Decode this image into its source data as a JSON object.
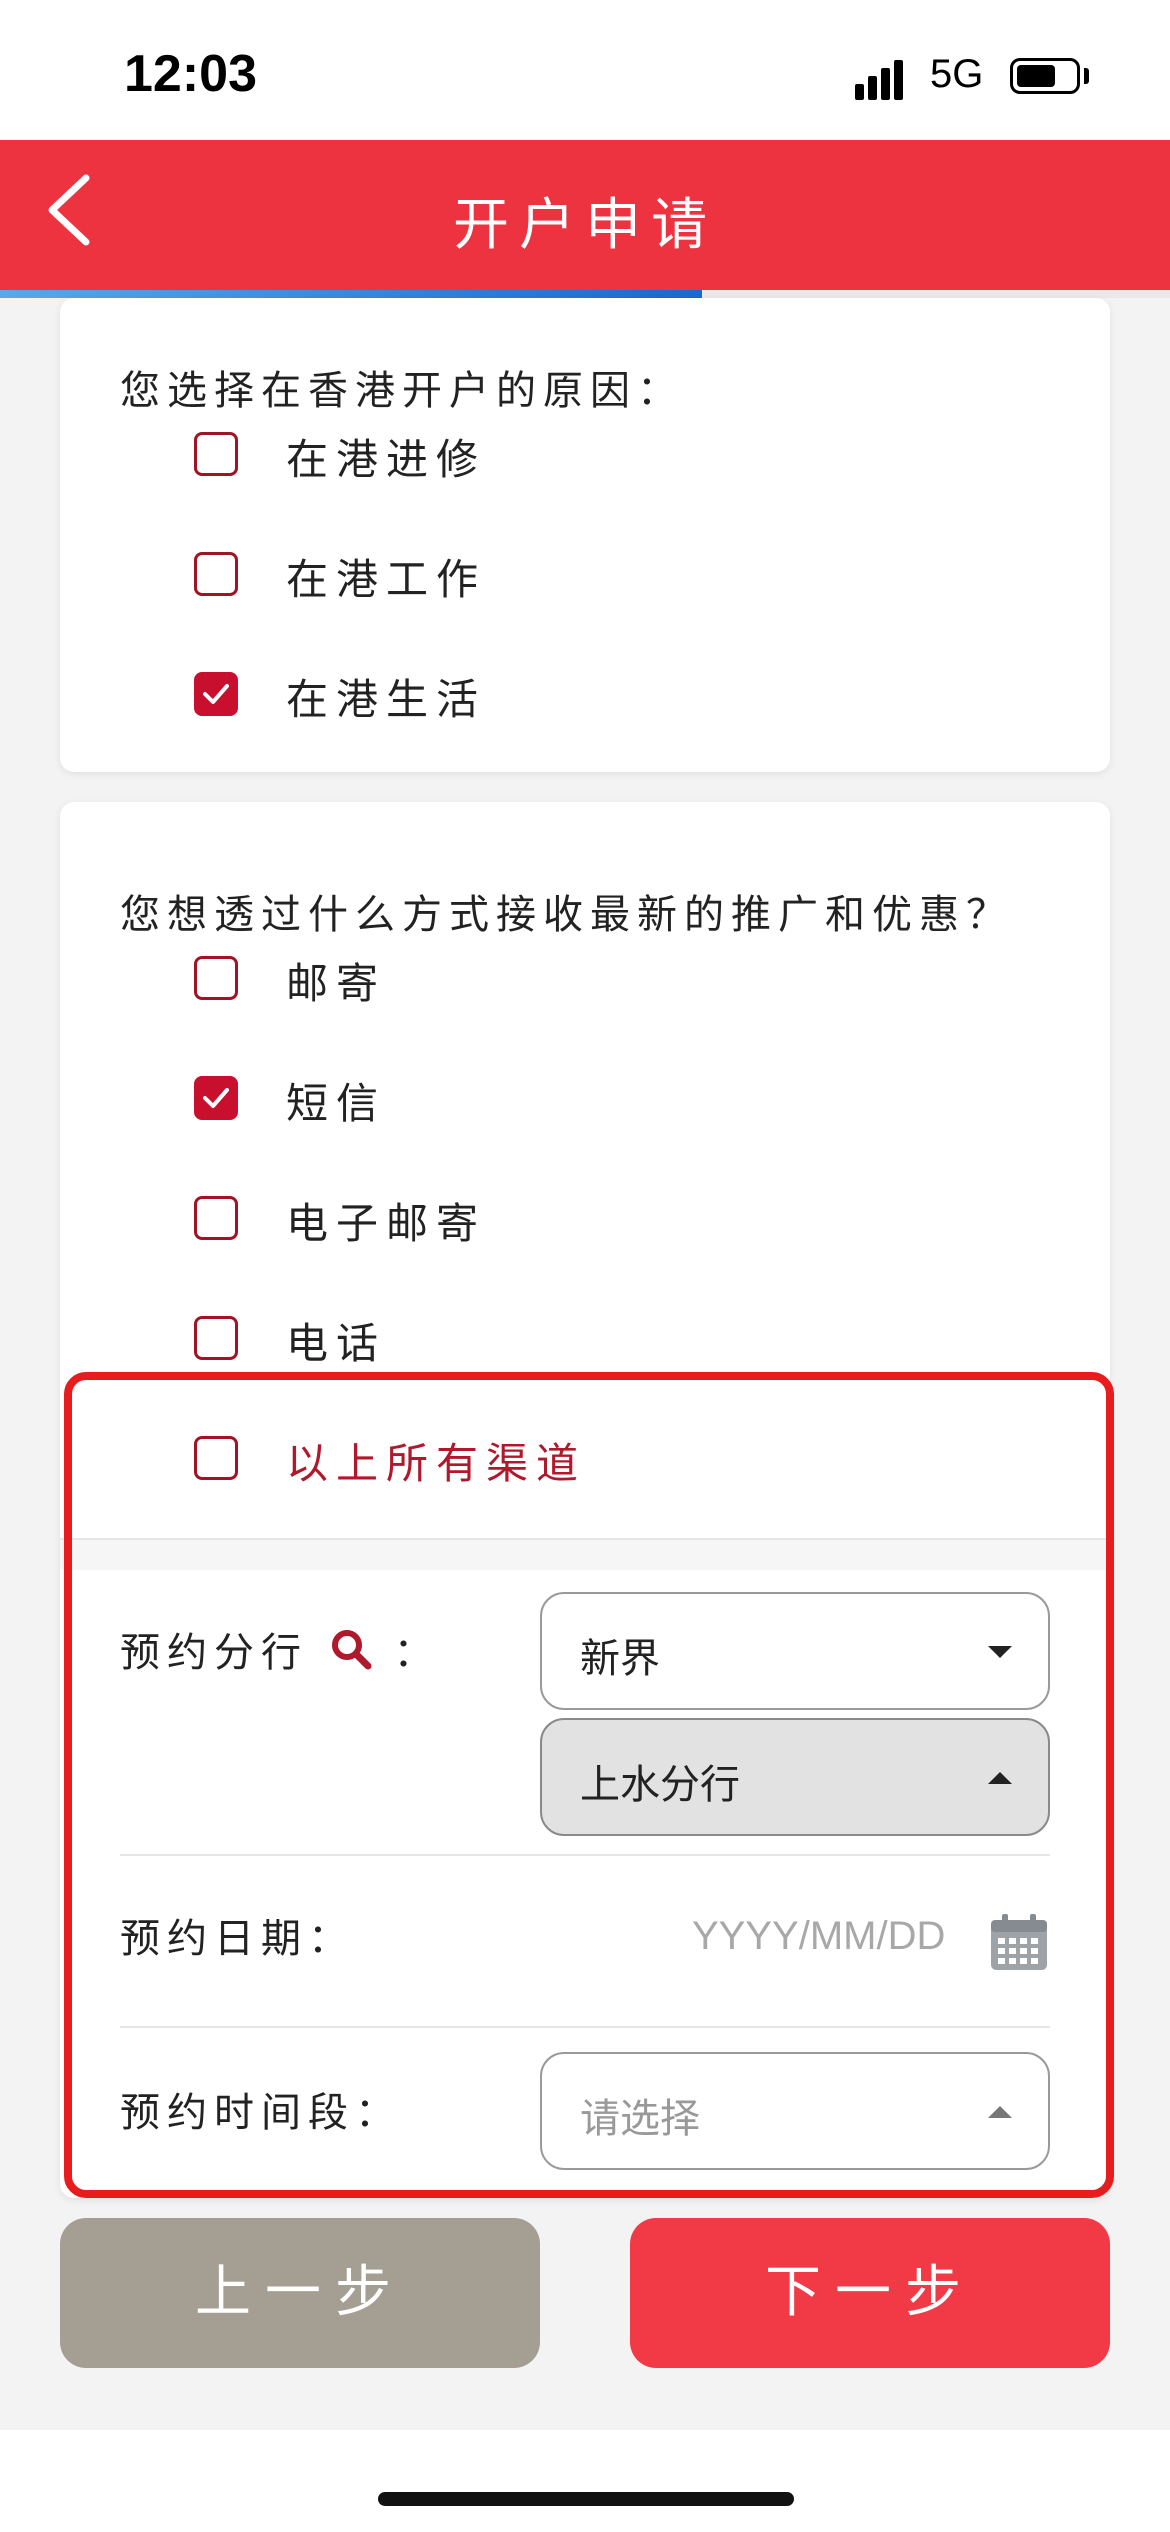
{
  "status_bar": {
    "time": "12:03",
    "network": "5G"
  },
  "header": {
    "title": "开户申请",
    "progress": 0.6
  },
  "reason": {
    "question": "您选择在香港开户的原因：",
    "options": [
      {
        "label": "在港进修",
        "checked": false
      },
      {
        "label": "在港工作",
        "checked": false
      },
      {
        "label": "在港生活",
        "checked": true
      }
    ]
  },
  "promotion": {
    "question": "您想透过什么方式接收最新的推广和优惠？",
    "options": [
      {
        "label": "邮寄",
        "checked": false
      },
      {
        "label": "短信",
        "checked": true
      },
      {
        "label": "电子邮寄",
        "checked": false
      },
      {
        "label": "电话",
        "checked": false
      },
      {
        "label": "以上所有渠道",
        "checked": false
      }
    ]
  },
  "appointment": {
    "branch_label": "预约分行",
    "colon": "：",
    "region_value": "新界",
    "branch_value": "上水分行",
    "date_label": "预约日期：",
    "date_placeholder": "YYYY/MM/DD",
    "time_label": "预约时间段：",
    "time_placeholder": "请选择"
  },
  "buttons": {
    "prev": "上一步",
    "next": "下一步"
  },
  "colors": {
    "brand_red": "#ee3340",
    "check_red": "#c8102e",
    "prev_gray": "#a59f93",
    "highlight": "#e81c1c"
  }
}
